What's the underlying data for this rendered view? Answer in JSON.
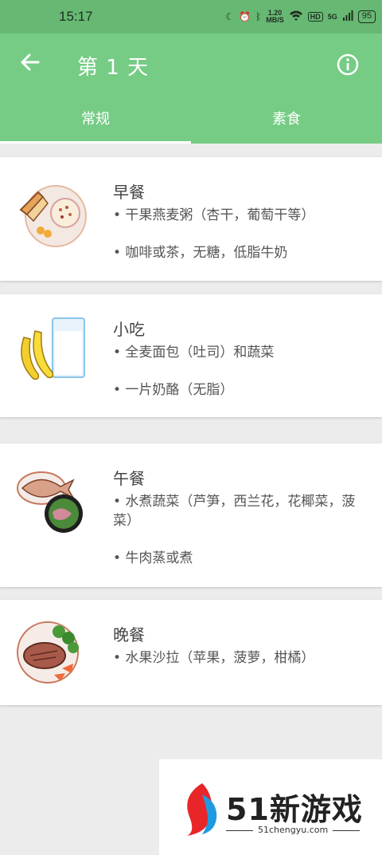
{
  "status": {
    "time": "15:17",
    "speed_top": "1.20",
    "speed_bottom": "MB/S",
    "hd": "HD",
    "signal": "5G",
    "battery": "95"
  },
  "header": {
    "title": "第 1 天"
  },
  "tabs": [
    {
      "label": "常规"
    },
    {
      "label": "素食"
    }
  ],
  "meals": [
    {
      "name": "早餐",
      "items": [
        "• 干果燕麦粥（杏干，葡萄干等）",
        "• 咖啡或茶，无糖，低脂牛奶"
      ]
    },
    {
      "name": "小吃",
      "items": [
        "• 全麦面包（吐司）和蔬菜",
        "• 一片奶酪（无脂）"
      ]
    },
    {
      "name": "午餐",
      "items": [
        "• 水煮蔬菜（芦笋，西兰花，花椰菜，菠菜）",
        "• 牛肉蒸或煮"
      ]
    },
    {
      "name": "晚餐",
      "items": [
        "• 水果沙拉（苹果，菠萝，柑橘）"
      ]
    }
  ],
  "watermark": {
    "brand": "51新游戏",
    "url": "51chengyu.com"
  },
  "colors": {
    "appbar": "#76cc85",
    "statusbar": "#67b872"
  }
}
